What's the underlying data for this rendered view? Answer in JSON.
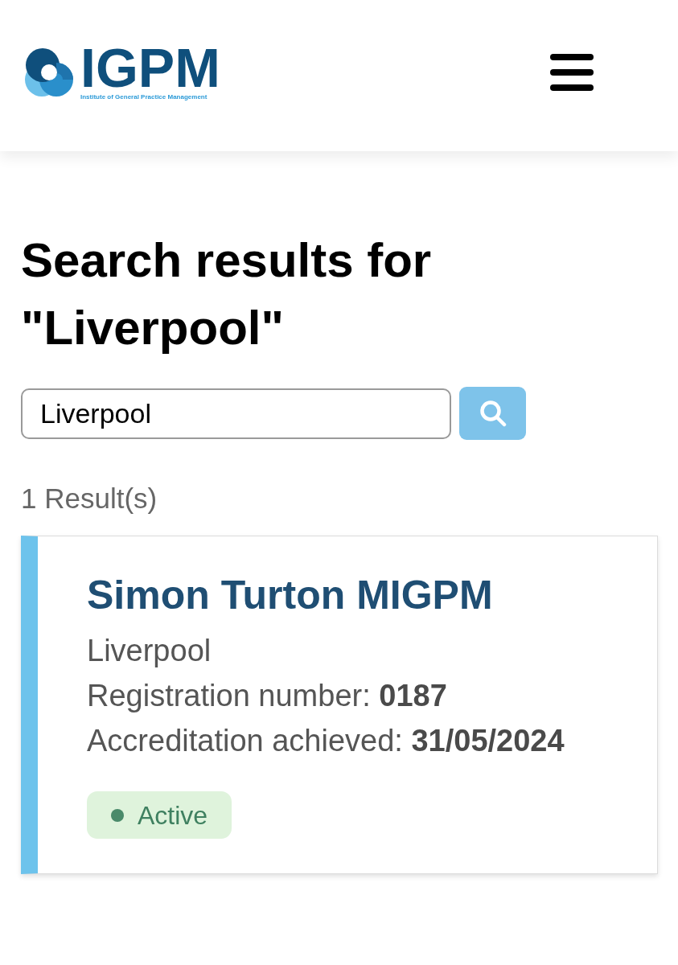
{
  "header": {
    "logo": {
      "wordmark": "IGPM",
      "tagline": "Institute of General Practice Management"
    }
  },
  "heading": "Search results for \"Liverpool\"",
  "search": {
    "value": "Liverpool"
  },
  "result_count": "1 Result(s)",
  "results": [
    {
      "name": "Simon Turton MIGPM",
      "location": "Liverpool",
      "details": [
        "Registration number: **0187**",
        "Accreditation achieved: **31/05/2024**"
      ],
      "status": {
        "label": "Active",
        "color": "#4a8a6a"
      }
    }
  ]
}
